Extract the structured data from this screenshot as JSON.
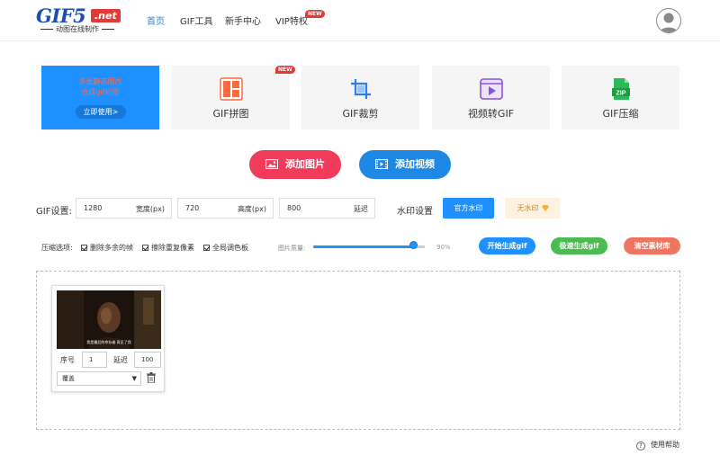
{
  "header": {
    "logo_main": "GIF5",
    "logo_net": ".net",
    "logo_sub": "动图在线制作",
    "nav": [
      "首页",
      "GIF工具",
      "新手中心",
      "VIP特权"
    ],
    "vip_badge": "NEW"
  },
  "promo": {
    "line1": "多张静态图片",
    "line2": "合成gif动图",
    "button": "立即使用>"
  },
  "tools": [
    {
      "label": "GIF拼图",
      "icon": "grid-icon",
      "badge": "NEW"
    },
    {
      "label": "GIF裁剪",
      "icon": "crop-icon"
    },
    {
      "label": "视频转GIF",
      "icon": "video-play-icon"
    },
    {
      "label": "GIF压缩",
      "icon": "zip-icon"
    }
  ],
  "actions": {
    "add_image": "添加图片",
    "add_video": "添加视频"
  },
  "settings": {
    "label": "GIF设置:",
    "width_value": "1280",
    "width_unit": "宽度(px)",
    "height_value": "720",
    "height_unit": "高度(px)",
    "delay_value": "800",
    "delay_unit": "延迟",
    "watermark_label": "水印设置",
    "official_watermark": "官方水印",
    "no_watermark": "无水印"
  },
  "compress": {
    "label": "压缩选项:",
    "options": [
      "删除多余的帧",
      "擦除重复像素",
      "全局调色板"
    ],
    "quality_label": "图片质量:",
    "quality_value": "90%",
    "quality_fraction": 0.9
  },
  "buttons": {
    "start": "开始生成gif",
    "fast": "极速生成gif",
    "clear": "清空素材库"
  },
  "frame": {
    "subtitle": "我是最后的幸存者 再见了我",
    "seq_label": "序号",
    "seq_value": "1",
    "delay_label": "延迟",
    "delay_value": "100",
    "select_value": "覆盖"
  },
  "help": "使用帮助",
  "colors": {
    "blue": "#1e90ff",
    "red": "#f03c5a",
    "green": "#4cbb52",
    "salmon": "#f07560"
  }
}
